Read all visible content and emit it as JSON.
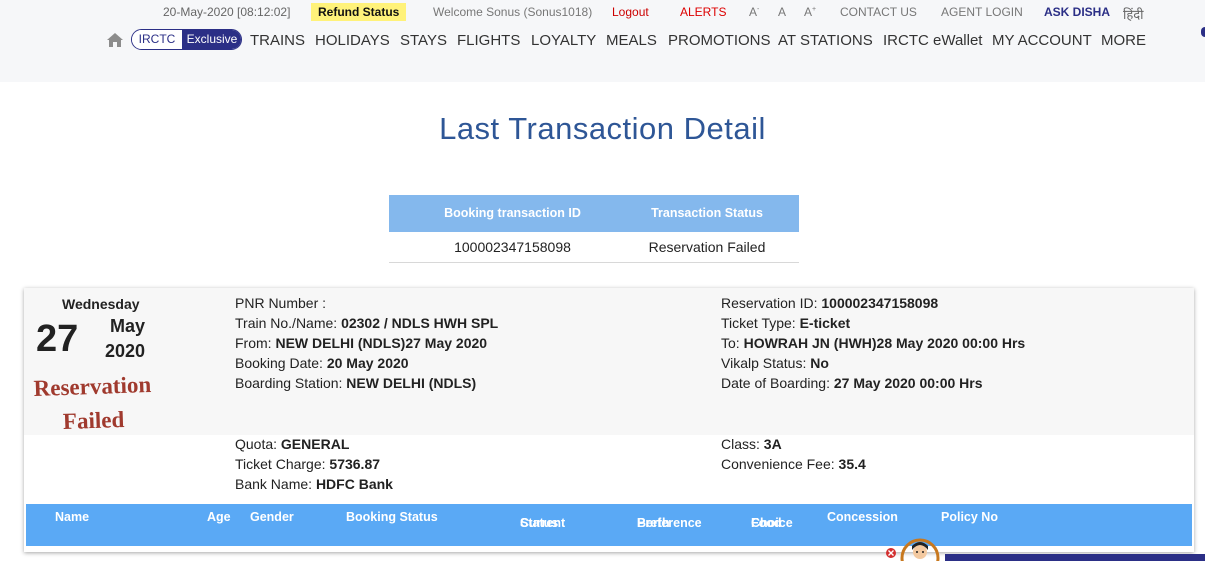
{
  "header": {
    "datetime": "20-May-2020 [08:12:02]",
    "refund_status": "Refund Status",
    "welcome": "Welcome Sonus (Sonus1018)",
    "logout": "Logout",
    "alerts": "ALERTS",
    "font_small": "A",
    "font_small_sup": "-",
    "font_normal": "A",
    "font_large": "A",
    "font_large_sup": "+",
    "contact_us": "CONTACT US",
    "agent_login": "AGENT LOGIN",
    "ask_disha": "ASK DISHA",
    "hindi": "हिंदी"
  },
  "nav": {
    "badge_left": "IRCTC",
    "badge_right": "Exclusive",
    "items": [
      "TRAINS",
      "HOLIDAYS",
      "STAYS",
      "FLIGHTS",
      "LOYALTY",
      "MEALS",
      "PROMOTIONS",
      "AT STATIONS",
      "IRCTC eWallet",
      "MY ACCOUNT",
      "MORE"
    ]
  },
  "page_title": "Last Transaction Detail",
  "transaction_table": {
    "headers": [
      "Booking transaction ID",
      "Transaction Status"
    ],
    "rows": [
      [
        "100002347158098",
        "Reservation Failed"
      ]
    ]
  },
  "ticket": {
    "weekday": "Wednesday",
    "day": "27",
    "month": "May",
    "year": "2020",
    "status_line1": "Reservation",
    "status_line2": "Failed",
    "left": [
      {
        "label": "PNR Number :",
        "value": ""
      },
      {
        "label": "Train No./Name: ",
        "value": "02302 / NDLS HWH SPL"
      },
      {
        "label": "From: ",
        "value": "NEW DELHI (NDLS)27 May 2020"
      },
      {
        "label": "Booking Date: ",
        "value": "20 May 2020"
      },
      {
        "label": "Boarding Station: ",
        "value": "NEW DELHI (NDLS)"
      }
    ],
    "right": [
      {
        "label": "Reservation ID: ",
        "value": "100002347158098"
      },
      {
        "label": "Ticket Type: ",
        "value": "E-ticket"
      },
      {
        "label": "To: ",
        "value": "HOWRAH JN (HWH)28 May 2020 00:00 Hrs"
      },
      {
        "label": "Vikalp Status: ",
        "value": "No"
      },
      {
        "label": "Date of Boarding: ",
        "value": "27 May 2020 00:00 Hrs"
      }
    ],
    "left2": [
      {
        "label": "Quota: ",
        "value": "GENERAL"
      },
      {
        "label": "Ticket Charge: ",
        "value": "5736.87"
      },
      {
        "label": "Bank Name: ",
        "value": "HDFC Bank"
      }
    ],
    "right2": [
      {
        "label": "Class: ",
        "value": "3A"
      },
      {
        "label": "Convenience Fee: ",
        "value": "35.4"
      }
    ]
  },
  "passenger_table": {
    "headers": [
      "Name",
      "Age",
      "Gender",
      "Booking Status",
      "Current",
      "Status",
      "Berth",
      "Preference",
      "Food",
      "Choice",
      "Concession",
      "Policy No"
    ]
  }
}
